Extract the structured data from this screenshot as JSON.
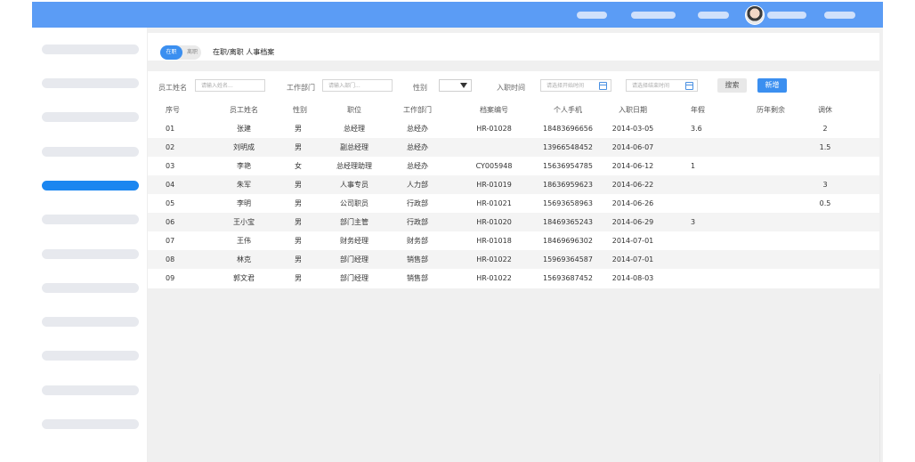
{
  "colors": {
    "topbar": "#5b9cf5",
    "accent": "#3b8ff0",
    "sidebar_active": "#1b86f0"
  },
  "header": {
    "avatar_icon": "user-avatar"
  },
  "breadcrumb": {
    "toggle_on": "在职",
    "toggle_off": "离职",
    "text": "在职/离职  人事档案"
  },
  "filters": {
    "name_label": "员工姓名",
    "name_placeholder": "请输入姓名...",
    "dept_label": "工作部门",
    "dept_placeholder": "请输入部门...",
    "gender_label": "性别",
    "join_label": "入职时间",
    "start_placeholder": "请选择开始时间",
    "end_placeholder": "请选择结束时间",
    "search_label": "搜索",
    "add_label": "新增"
  },
  "table": {
    "columns": [
      "序号",
      "员工姓名",
      "性别",
      "职位",
      "工作部门",
      "档案编号",
      "个人手机",
      "入职日期",
      "年假",
      "历年剩余",
      "调休"
    ],
    "rows": [
      [
        "01",
        "张建",
        "男",
        "总经理",
        "总经办",
        "HR-01028",
        "18483696656",
        "2014-03-05",
        "3.6",
        "",
        "2"
      ],
      [
        "02",
        "刘明成",
        "男",
        "副总经理",
        "总经办",
        "",
        "13966548452",
        "2014-06-07",
        "",
        "",
        "1.5"
      ],
      [
        "03",
        "李艳",
        "女",
        "总经理助理",
        "总经办",
        "CY005948",
        "15636954785",
        "2014-06-12",
        "1",
        "",
        ""
      ],
      [
        "04",
        "朱军",
        "男",
        "人事专员",
        "人力部",
        "HR-01019",
        "18636959623",
        "2014-06-22",
        "",
        "",
        "3"
      ],
      [
        "05",
        "李明",
        "男",
        "公司职员",
        "行政部",
        "HR-01021",
        "15693658963",
        "2014-06-26",
        "",
        "",
        "0.5"
      ],
      [
        "06",
        "王小宝",
        "男",
        "部门主管",
        "行政部",
        "HR-01020",
        "18469365243",
        "2014-06-29",
        "3",
        "",
        ""
      ],
      [
        "07",
        "王伟",
        "男",
        "财务经理",
        "财务部",
        "HR-01018",
        "18469696302",
        "2014-07-01",
        "",
        "",
        ""
      ],
      [
        "08",
        "林克",
        "男",
        "部门经理",
        "销售部",
        "HR-01022",
        "15969364587",
        "2014-07-01",
        "",
        "",
        ""
      ],
      [
        "09",
        "郭文君",
        "男",
        "部门经理",
        "销售部",
        "HR-01022",
        "15693687452",
        "2014-08-03",
        "",
        "",
        ""
      ]
    ]
  }
}
